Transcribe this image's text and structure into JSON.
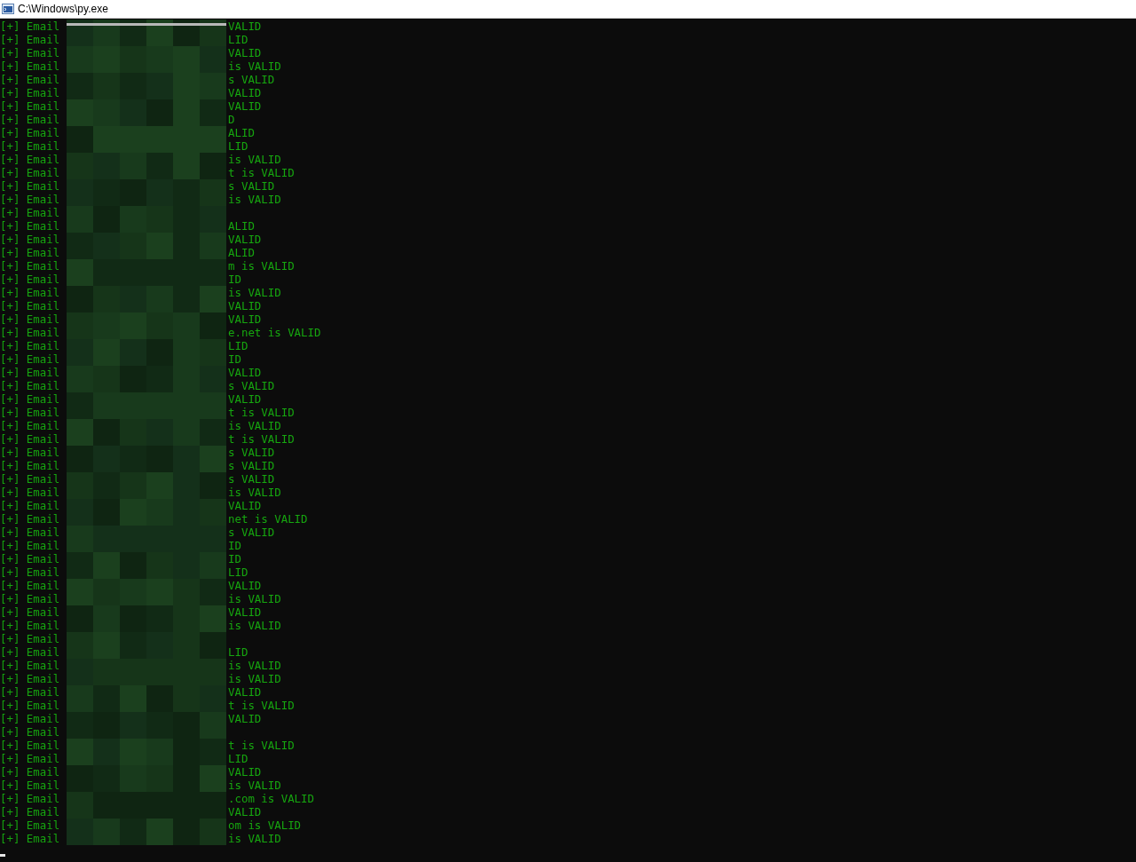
{
  "window": {
    "title": "C:\\Windows\\py.exe"
  },
  "lines": [
    {
      "prefix": "[+] Email",
      "tail": "VALID"
    },
    {
      "prefix": "[+] Email",
      "tail": "LID"
    },
    {
      "prefix": "[+] Email",
      "tail": "VALID"
    },
    {
      "prefix": "[+] Email",
      "tail": "is VALID"
    },
    {
      "prefix": "[+] Email",
      "tail": "s VALID"
    },
    {
      "prefix": "[+] Email",
      "tail": "VALID"
    },
    {
      "prefix": "[+] Email",
      "tail": "VALID"
    },
    {
      "prefix": "[+] Email",
      "tail": "D"
    },
    {
      "prefix": "[+] Email",
      "tail": "ALID"
    },
    {
      "prefix": "[+] Email",
      "tail": "LID"
    },
    {
      "prefix": "[+] Email",
      "tail": "is VALID"
    },
    {
      "prefix": "[+] Email",
      "tail": "t is VALID"
    },
    {
      "prefix": "[+] Email",
      "tail": "s VALID"
    },
    {
      "prefix": "[+] Email",
      "tail": "is VALID"
    },
    {
      "prefix": "[+] Email"
    },
    {
      "prefix": "[+] Email",
      "tail": "ALID"
    },
    {
      "prefix": "[+] Email",
      "tail": "VALID"
    },
    {
      "prefix": "[+] Email",
      "tail": "ALID"
    },
    {
      "prefix": "[+] Email",
      "tail": "m is VALID"
    },
    {
      "prefix": "[+] Email",
      "tail": "ID"
    },
    {
      "prefix": "[+] Email",
      "tail": "is VALID"
    },
    {
      "prefix": "[+] Email",
      "tail": "VALID"
    },
    {
      "prefix": "[+] Email",
      "tail": "VALID"
    },
    {
      "prefix": "[+] Email",
      "tail": "e.net is VALID"
    },
    {
      "prefix": "[+] Email",
      "tail": "LID"
    },
    {
      "prefix": "[+] Email",
      "tail": "ID"
    },
    {
      "prefix": "[+] Email",
      "tail": "VALID"
    },
    {
      "prefix": "[+] Email",
      "tail": "s VALID"
    },
    {
      "prefix": "[+] Email",
      "tail": "VALID"
    },
    {
      "prefix": "[+] Email",
      "tail": "t is VALID"
    },
    {
      "prefix": "[+] Email",
      "tail": "is VALID"
    },
    {
      "prefix": "[+] Email",
      "tail": "t is VALID"
    },
    {
      "prefix": "[+] Email",
      "tail": "s VALID"
    },
    {
      "prefix": "[+] Email",
      "tail": "s VALID"
    },
    {
      "prefix": "[+] Email",
      "tail": "s VALID"
    },
    {
      "prefix": "[+] Email",
      "tail": "is VALID"
    },
    {
      "prefix": "[+] Email",
      "tail": "VALID"
    },
    {
      "prefix": "[+] Email",
      "tail": "net is VALID"
    },
    {
      "prefix": "[+] Email",
      "tail": "s VALID"
    },
    {
      "prefix": "[+] Email",
      "tail": "ID"
    },
    {
      "prefix": "[+] Email",
      "tail": "ID"
    },
    {
      "prefix": "[+] Email",
      "tail": "LID"
    },
    {
      "prefix": "[+] Email",
      "tail": "VALID"
    },
    {
      "prefix": "[+] Email",
      "tail": "is VALID"
    },
    {
      "prefix": "[+] Email",
      "tail": "VALID"
    },
    {
      "prefix": "[+] Email",
      "tail": "is VALID"
    },
    {
      "prefix": "[+] Email"
    },
    {
      "prefix": "[+] Email",
      "tail": "LID"
    },
    {
      "prefix": "[+] Email",
      "tail": "is VALID"
    },
    {
      "prefix": "[+] Email",
      "tail": "is VALID"
    },
    {
      "prefix": "[+] Email",
      "tail": "VALID"
    },
    {
      "prefix": "[+] Email",
      "tail": "t is VALID"
    },
    {
      "prefix": "[+] Email",
      "tail": "VALID"
    },
    {
      "prefix": "[+] Email"
    },
    {
      "prefix": "[+] Email",
      "tail": "t is VALID"
    },
    {
      "prefix": "[+] Email",
      "tail": "LID"
    },
    {
      "prefix": "[+] Email",
      "tail": "VALID"
    },
    {
      "prefix": "[+] Email",
      "tail": "is VALID"
    },
    {
      "prefix": "[+] Email",
      "tail": ".com is VALID"
    },
    {
      "prefix": "[+] Email",
      "tail": "VALID"
    },
    {
      "prefix": "[+] Email",
      "tail": "om is VALID"
    },
    {
      "prefix": "[+] Email",
      "tail": "is VALID"
    }
  ]
}
